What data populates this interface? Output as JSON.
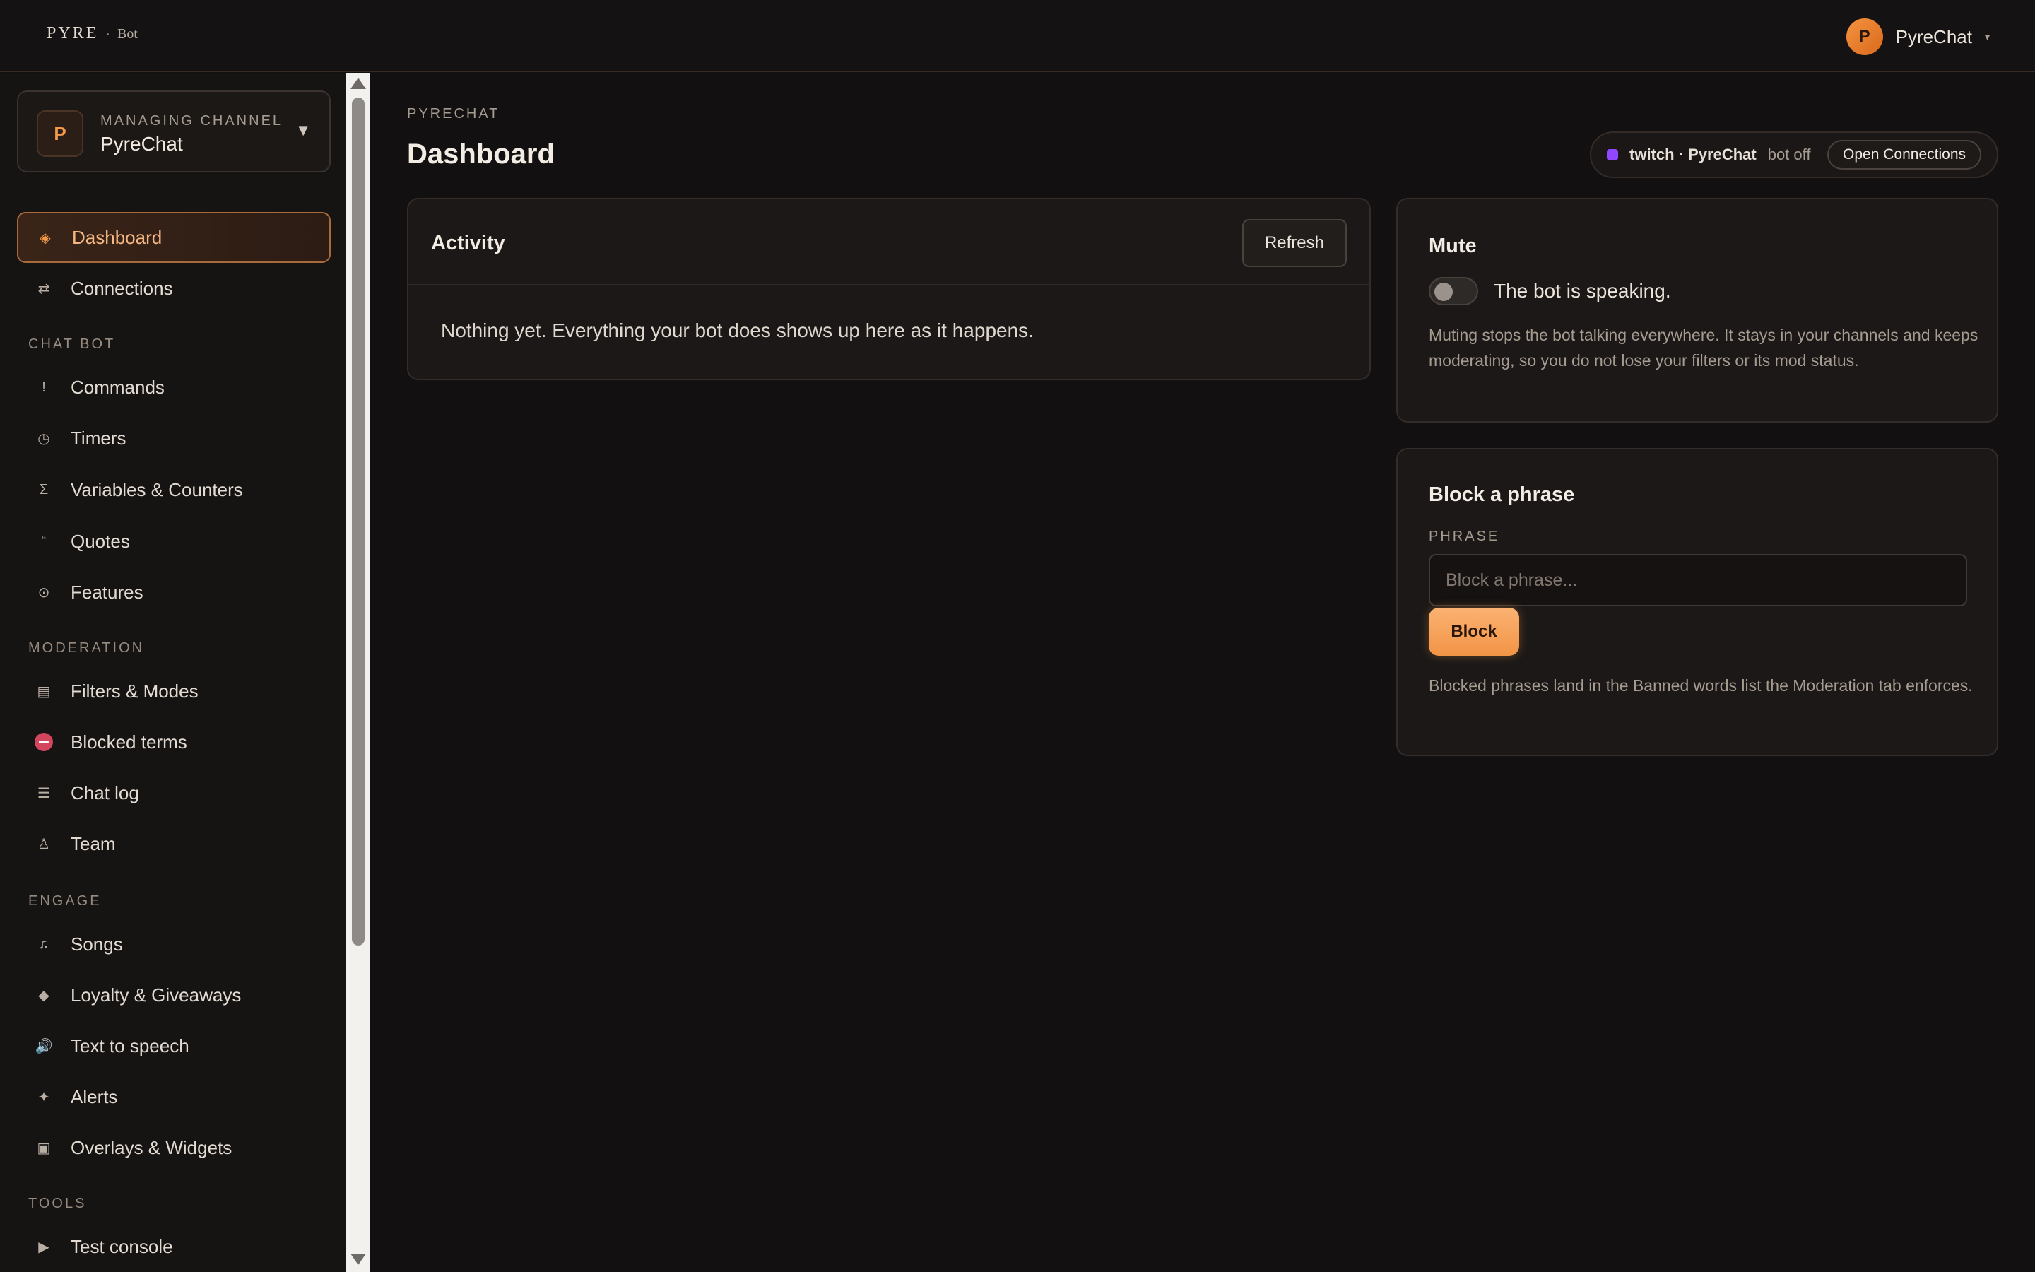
{
  "topbar": {
    "logo_brand": "PYRE",
    "logo_sep": "·",
    "logo_sub": "Bot",
    "user_initial": "P",
    "user_name": "PyreChat",
    "user_caret": "▾"
  },
  "channel": {
    "initial": "P",
    "label": "MANAGING CHANNEL",
    "name": "PyreChat",
    "caret": "▼"
  },
  "sidebar": {
    "dashboard": "Dashboard",
    "connections": "Connections",
    "section_chatbot": "CHAT BOT",
    "commands": "Commands",
    "timers": "Timers",
    "variables": "Variables & Counters",
    "quotes": "Quotes",
    "features": "Features",
    "section_moderation": "MODERATION",
    "filters": "Filters & Modes",
    "blocked": "Blocked terms",
    "chatlog": "Chat log",
    "team": "Team",
    "section_engage": "ENGAGE",
    "songs": "Songs",
    "loyalty": "Loyalty & Giveaways",
    "tts": "Text to speech",
    "alerts": "Alerts",
    "overlays": "Overlays & Widgets",
    "section_tools": "TOOLS",
    "console": "Test console"
  },
  "icons": {
    "dashboard": "diamond-icon",
    "connections": "swap-icon",
    "commands": "exclamation-icon",
    "timers": "clock-icon",
    "variables": "sigma-icon",
    "quotes": "quote-icon",
    "features": "gear-icon",
    "filters": "filter-list-icon",
    "blocked": "no-entry-icon",
    "chatlog": "list-icon",
    "team": "person-icon",
    "songs": "music-note-icon",
    "loyalty": "diamond-small-icon",
    "tts": "speaker-icon",
    "alerts": "sparkle-icon",
    "overlays": "square-icon",
    "console": "play-icon"
  },
  "header": {
    "breadcrumb": "PYRECHAT",
    "title": "Dashboard"
  },
  "status": {
    "platform": "twitch · PyreChat",
    "bot_state": "bot off",
    "open_connections": "Open Connections",
    "platform_color": "#9146ff"
  },
  "activity": {
    "title": "Activity",
    "refresh": "Refresh",
    "empty": "Nothing yet. Everything your bot does shows up here as it happens."
  },
  "mute": {
    "title": "Mute",
    "toggle_on": false,
    "state_text": "The bot is speaking.",
    "description": "Muting stops the bot talking everywhere. It stays in your channels and keeps moderating, so you do not lose your filters or its mod status."
  },
  "block": {
    "title": "Block a phrase",
    "label": "PHRASE",
    "placeholder": "Block a phrase...",
    "value": "",
    "button": "Block",
    "description": "Blocked phrases land in the Banned words list the Moderation tab enforces."
  },
  "colors": {
    "accent": "#f39a4a",
    "background": "#121010",
    "card": "#1b1817"
  }
}
